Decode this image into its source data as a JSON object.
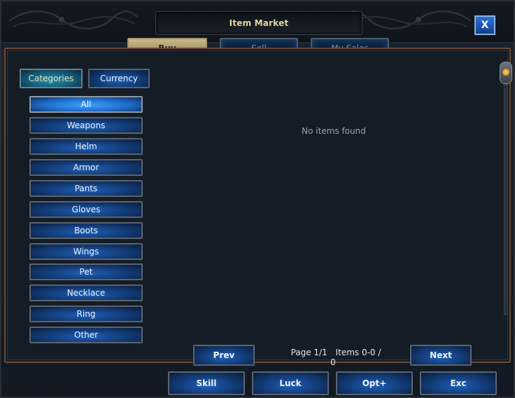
{
  "window": {
    "title": "Item Market",
    "close_label": "X"
  },
  "tabs": [
    {
      "label": "Buy",
      "active": true
    },
    {
      "label": "Sell",
      "active": false
    },
    {
      "label": "My Sales",
      "active": false
    }
  ],
  "filters": [
    {
      "label": "Categories",
      "selected": true
    },
    {
      "label": "Currency",
      "selected": false
    }
  ],
  "categories": [
    {
      "label": "All",
      "selected": true
    },
    {
      "label": "Weapons"
    },
    {
      "label": "Helm"
    },
    {
      "label": "Armor"
    },
    {
      "label": "Pants"
    },
    {
      "label": "Gloves"
    },
    {
      "label": "Boots"
    },
    {
      "label": "Wings"
    },
    {
      "label": "Pet"
    },
    {
      "label": "Necklace"
    },
    {
      "label": "Ring"
    },
    {
      "label": "Other"
    }
  ],
  "listing": {
    "empty_message": "No items found"
  },
  "pagination": {
    "prev_label": "Prev",
    "next_label": "Next",
    "page_text": "Page 1/1",
    "items_text": "Items 0-0 / 0"
  },
  "bottom_buttons": [
    {
      "label": "Skill"
    },
    {
      "label": "Luck"
    },
    {
      "label": "Opt+"
    },
    {
      "label": "Exc"
    }
  ],
  "colors": {
    "title_gold": "#e7d79a",
    "accent_blue": "#1f6cc8",
    "panel_border": "#6b4a35"
  }
}
